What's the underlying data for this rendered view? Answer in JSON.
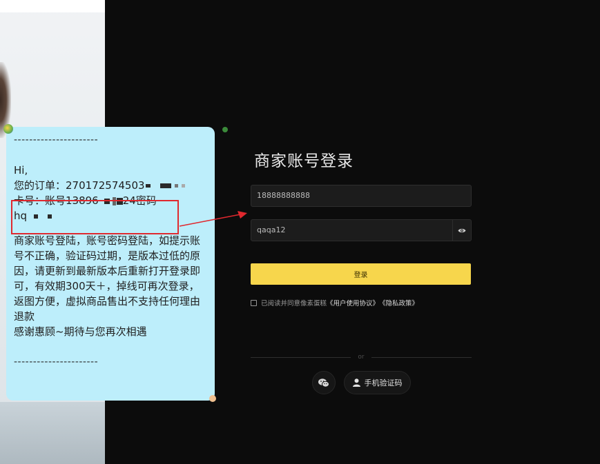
{
  "chat": {
    "dash_top": "----------------------",
    "greeting": "Hi,",
    "order_label": "您的订单：",
    "order_number": "270172574503",
    "card_label": "卡号：账号13896",
    "card_suffix": "24密码",
    "password_prefix": "hq",
    "message": "商家账号登陆，账号密码登陆，如提示账号不正确，验证码过期，是版本过低的原因，请更新到最新版本后重新打开登录即可，有效期300天＋，掉线可再次登录，返图方便，虚拟商品售出不支持任何理由退款",
    "thanks": "感谢惠顾~期待与您再次相遇",
    "dash_bottom": "----------------------"
  },
  "login": {
    "title": "商家账号登录",
    "account_value": "18888888888",
    "password_value": "qaqa12",
    "login_button": "登录",
    "agree_text": "已阅读并同意像素蛋糕",
    "user_agreement": "《用户使用协议》",
    "privacy_policy": "《隐私政策》",
    "divider_text": "or",
    "phone_login": "手机验证码"
  },
  "colors": {
    "background": "#0c0c0c",
    "bubble": "#bdeefb",
    "accent_yellow": "#f7d64c",
    "highlight_red": "#e0282e"
  },
  "icons": [
    "eye-icon",
    "wechat-icon",
    "user-icon",
    "arrow-icon"
  ]
}
